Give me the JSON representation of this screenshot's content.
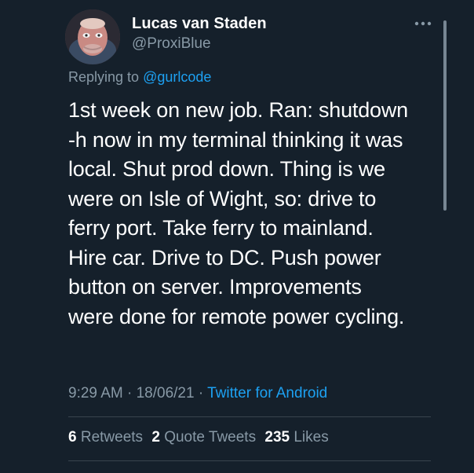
{
  "author": {
    "display_name": "Lucas van Staden",
    "handle": "@ProxiBlue",
    "avatar_icon": "user-avatar"
  },
  "reply": {
    "prefix": "Replying to",
    "mention": "@gurlcode"
  },
  "tweet": {
    "lines": [
      "1st week on new job. Ran: shutdown",
      "-h now in my terminal thinking it was",
      "local. Shut prod down. Thing is we",
      "were on Isle of Wight, so: drive to",
      "ferry port. Take ferry to mainland.",
      "Hire car. Drive to DC. Push power",
      "button on server. Improvements",
      "were done for remote power cycling."
    ]
  },
  "meta": {
    "time": "9:29 AM",
    "separator": "·",
    "date": "18/06/21",
    "source": "Twitter for Android"
  },
  "stats": {
    "retweets_count": "6",
    "retweets_label": "Retweets",
    "quote_count": "2",
    "quote_label": "Quote Tweets",
    "likes_count": "235",
    "likes_label": "Likes"
  },
  "colors": {
    "background": "#15202b",
    "text_primary": "#ffffff",
    "text_secondary": "#8899a6",
    "accent": "#1da1f2",
    "divider": "#38444d"
  }
}
